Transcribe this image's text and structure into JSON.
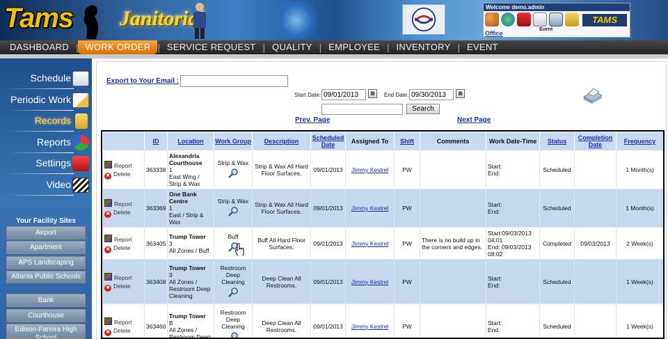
{
  "header": {
    "logo_text": "Tams",
    "module_text": "Janitorial",
    "welcome": "Welcome demo.admin",
    "office_link": "Office",
    "event_label": "Event",
    "mini_logo": "TAMS"
  },
  "topnav": {
    "items": [
      "DASHBOARD",
      "WORK ORDER",
      "SERVICE REQUEST",
      "QUALITY",
      "EMPLOYEE",
      "INVENTORY",
      "EVENT"
    ],
    "active": "WORK ORDER"
  },
  "sidebar": {
    "items": [
      "Schedule",
      "Periodic Work",
      "Records",
      "Reports",
      "Settings",
      "Video"
    ],
    "active": "Records",
    "sites_title": "Your Facility Sites",
    "sites": [
      "Airport",
      "Apartment",
      "APS Landscaping",
      "Atlanta Public Schools",
      "Bank",
      "Courthouse",
      "Edison-Fareira High School"
    ]
  },
  "filters": {
    "export_label": "Export to Your Email :",
    "export_value": "",
    "start_label": "Start Date:",
    "start_value": "09/01/2013",
    "end_label": "End Date:",
    "end_value": "09/30/2013",
    "search_value": "",
    "search_button": "Search",
    "prev_page": "Prev. Page",
    "next_page": "Next Page"
  },
  "table": {
    "columns": [
      "ID",
      "Location",
      "Work Group",
      "Description",
      "Scheduled Date",
      "Assigned To",
      "Shift",
      "Comments",
      "Work Date-Time",
      "Status",
      "Completion Date",
      "Frequency"
    ],
    "report_label": "Report",
    "delete_label": "Delete",
    "rows": [
      {
        "id": "363338",
        "loc_name": "Alexandria Courthouse",
        "loc_detail": "1\nEast Wing / Strip & Wax",
        "work_group": "Strip & Wax",
        "description": "Strip & Wax All Hard Floor Surfaces.",
        "scheduled": "09/01/2013",
        "assigned": "Jimmy Kestrel",
        "shift": "PW",
        "comments": "",
        "work_dt": "Start:\nEnd:",
        "status": "Scheduled",
        "completion": "",
        "frequency": "1 Month(s)"
      },
      {
        "id": "363369",
        "loc_name": "One Bank Centre",
        "loc_detail": "1\nEast / Strip & Wax",
        "work_group": "Strip & Wax",
        "description": "Strip & Wax All Hard Floor Surfaces.",
        "scheduled": "09/01/2013",
        "assigned": "Jimmy Kestrel",
        "shift": "PW",
        "comments": "",
        "work_dt": "Start:\nEnd:",
        "status": "Scheduled",
        "completion": "",
        "frequency": "1 Month(s)"
      },
      {
        "id": "363405",
        "loc_name": "Trump Tower",
        "loc_detail": "3\nAll Zones / Buff",
        "work_group": "Buff",
        "description": "Buff All Hard Floor Surfaces.",
        "scheduled": "09/01/2013",
        "assigned": "Jimmy Kestrel",
        "shift": "PW",
        "comments": "There is no build up in the corners and edges.",
        "work_dt": "Start:09/03/2013 04:01\nEnd: 09/03/2013 08:02",
        "status": "Completed",
        "completion": "09/03/2013",
        "frequency": "2 Week(s)"
      },
      {
        "id": "363408",
        "loc_name": "Trump Tower",
        "loc_detail": "3\nAll Zones / Restroom Deep Cleaning",
        "work_group": "Restroom Deep Cleaning",
        "description": "Deep Clean All Restrooms.",
        "scheduled": "09/01/2013",
        "assigned": "Jimmy Kestrel",
        "shift": "PW",
        "comments": "",
        "work_dt": "Start:\nEnd:",
        "status": "Scheduled",
        "completion": "",
        "frequency": "1 Week(s)"
      },
      {
        "id": "363460",
        "loc_name": "Trump Tower",
        "loc_detail": "B\nAll Zones / Restroom Deep",
        "work_group": "Restroom Deep Cleaning",
        "description": "Deep Clean All Restrooms.",
        "scheduled": "09/01/2013",
        "assigned": "Jimmy Kestrel",
        "shift": "PW",
        "comments": "",
        "work_dt": "Start:\nEnd:",
        "status": "Scheduled",
        "completion": "",
        "frequency": "1 Week(s)"
      }
    ]
  },
  "colors": {
    "accent_orange": "#e07a10",
    "link_blue": "#1a2faa",
    "row_blue": "#c6d8f0",
    "sidebar_blue": "#2d629f"
  }
}
